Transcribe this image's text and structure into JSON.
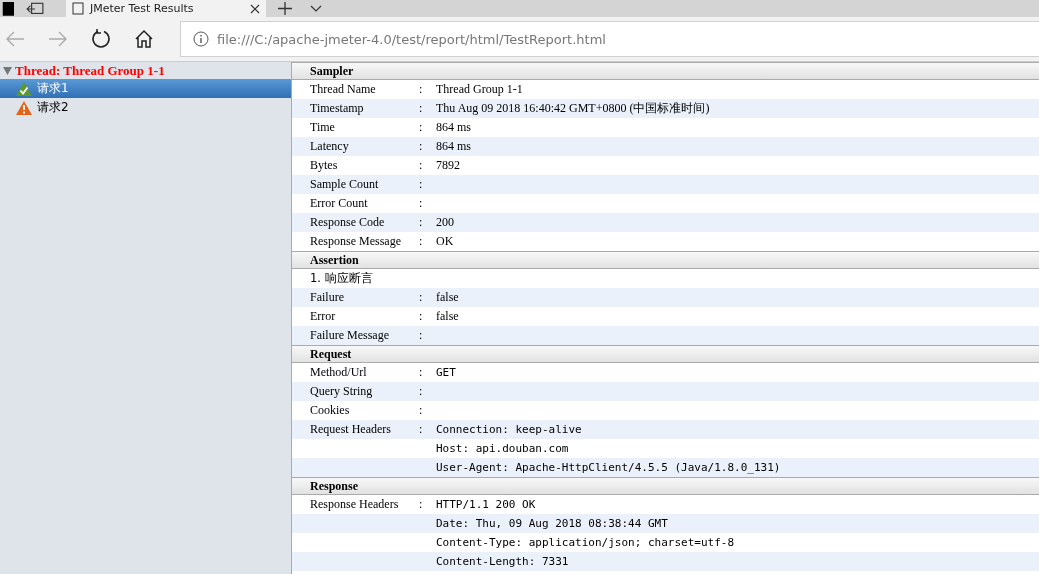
{
  "browser": {
    "tab": {
      "title": "JMeter Test Results",
      "selected": true
    },
    "address": "file:///C:/apache-jmeter-4.0/test/report/html/TestReport.html"
  },
  "tree": {
    "label": "Thread: Thread Group 1-1",
    "expanded": true,
    "children": [
      {
        "label": "请求1",
        "kind": "success",
        "selected": true
      },
      {
        "label": "请求2",
        "kind": "failure",
        "selected": false
      }
    ]
  },
  "sections": [
    {
      "title": "Sampler",
      "rows": [
        {
          "kind": "field",
          "label": "Thread Name",
          "separator": ":",
          "value": "Thread Group 1-1",
          "mono": false
        },
        {
          "kind": "field",
          "label": "Timestamp",
          "separator": ":",
          "value": "Thu Aug 09 2018 16:40:42 GMT+0800 (中国标准时间)",
          "mono": false
        },
        {
          "kind": "field",
          "label": "Time",
          "separator": ":",
          "value": "864 ms",
          "mono": false
        },
        {
          "kind": "field",
          "label": "Latency",
          "separator": ":",
          "value": "864 ms",
          "mono": false
        },
        {
          "kind": "field",
          "label": "Bytes",
          "separator": ":",
          "value": "7892",
          "mono": false
        },
        {
          "kind": "field",
          "label": "Sample Count",
          "separator": ":"
        },
        {
          "kind": "field",
          "label": "Error Count",
          "separator": ":"
        },
        {
          "kind": "field",
          "label": "Response Code",
          "separator": ":",
          "value": "200",
          "mono": false
        },
        {
          "kind": "field",
          "label": "Response Message",
          "separator": ":",
          "value": "OK",
          "mono": false
        }
      ]
    },
    {
      "title": "Assertion",
      "rows": [
        {
          "kind": "heading",
          "label": "1. 响应断言"
        },
        {
          "kind": "field",
          "label": "Failure",
          "separator": ":",
          "value": "false",
          "mono": false
        },
        {
          "kind": "field",
          "label": "Error",
          "separator": ":",
          "value": "false",
          "mono": false
        },
        {
          "kind": "field",
          "label": "Failure Message",
          "separator": ":"
        }
      ]
    },
    {
      "title": "Request",
      "rows": [
        {
          "kind": "field",
          "label": "Method/Url",
          "separator": ":",
          "value": "GET",
          "mono": true
        },
        {
          "kind": "field",
          "label": "Query String",
          "separator": ":"
        },
        {
          "kind": "field",
          "label": "Cookies",
          "separator": ":"
        },
        {
          "kind": "field",
          "label": "Request Headers",
          "separator": ":",
          "value": "Connection: keep-alive",
          "mono": true
        },
        {
          "kind": "continuation",
          "value": "Host: api.douban.com",
          "mono": true
        },
        {
          "kind": "continuation",
          "value": "User-Agent: Apache-HttpClient/4.5.5 (Java/1.8.0_131)",
          "mono": true
        }
      ]
    },
    {
      "title": "Response",
      "rows": [
        {
          "kind": "field",
          "label": "Response Headers",
          "separator": ":",
          "value": "HTTP/1.1 200 OK",
          "mono": true
        },
        {
          "kind": "continuation",
          "value": "Date: Thu, 09 Aug 2018 08:38:44 GMT",
          "mono": true
        },
        {
          "kind": "continuation",
          "value": "Content-Type: application/json; charset=utf-8",
          "mono": true
        },
        {
          "kind": "continuation",
          "value": "Content-Length: 7331",
          "mono": true
        }
      ]
    }
  ]
}
